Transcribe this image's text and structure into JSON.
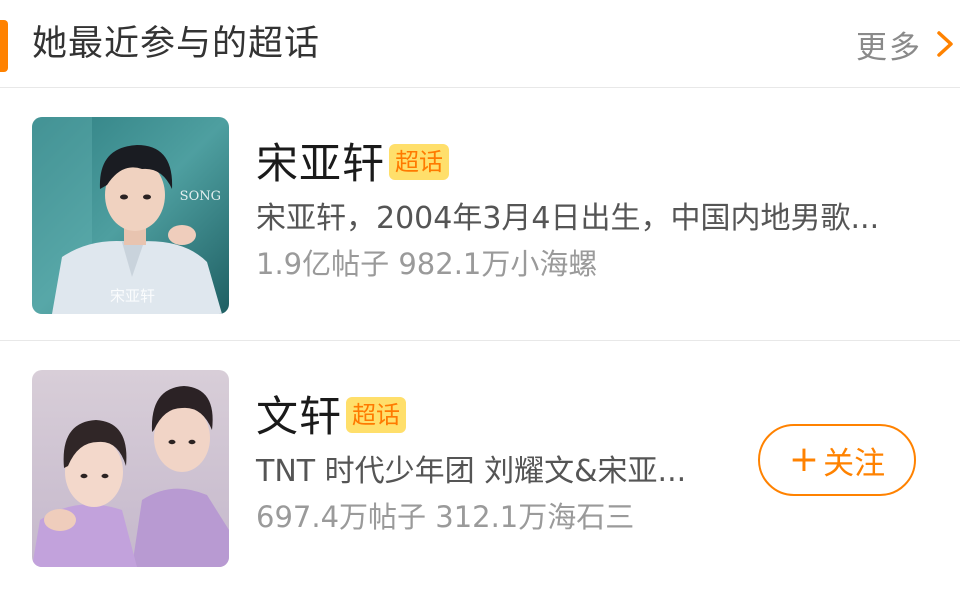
{
  "header": {
    "title": "她最近参与的超话",
    "more_label": "更多",
    "more_icon": "chevron-right-icon",
    "accent_color": "#ff8200"
  },
  "topics": [
    {
      "name": "宋亚轩",
      "badge": "超话",
      "description": "宋亚轩，2004年3月4日出生，中国内地男歌...",
      "stats": "1.9亿帖子 982.1万小海螺",
      "thumbnail_caption_top": "SONG",
      "thumbnail_caption_bottom": "宋亚轩"
    },
    {
      "name": "文轩",
      "badge": "超话",
      "description": "TNT 时代少年团 刘耀文&宋亚...",
      "stats": "697.4万帖子 312.1万海石三",
      "follow_label": "关注",
      "follow_icon": "plus-icon"
    }
  ],
  "colors": {
    "badge_bg": "#ffdf6b",
    "badge_text": "#ff7a00",
    "follow": "#ff8200"
  }
}
